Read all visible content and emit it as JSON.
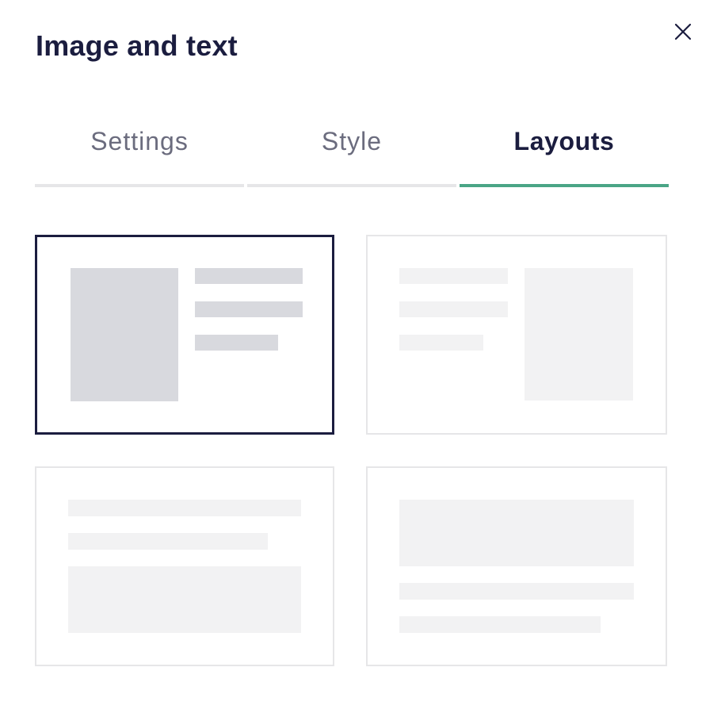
{
  "dialog": {
    "title": "Image and text"
  },
  "icons": {
    "close": "close-icon"
  },
  "tabs": [
    {
      "label": "Settings",
      "active": false
    },
    {
      "label": "Style",
      "active": false
    },
    {
      "label": "Layouts",
      "active": true
    }
  ],
  "layouts": [
    {
      "name": "image-left-text-right",
      "selected": true
    },
    {
      "name": "text-left-image-right",
      "selected": false
    },
    {
      "name": "text-top-image-bottom",
      "selected": false
    },
    {
      "name": "image-top-text-bottom",
      "selected": false
    }
  ],
  "colors": {
    "accent": "#4aa586",
    "selected_border": "#1b1d3f",
    "placeholder_selected": "#d8d9de",
    "placeholder": "#f2f2f3",
    "card_border": "#e6e6e8"
  }
}
